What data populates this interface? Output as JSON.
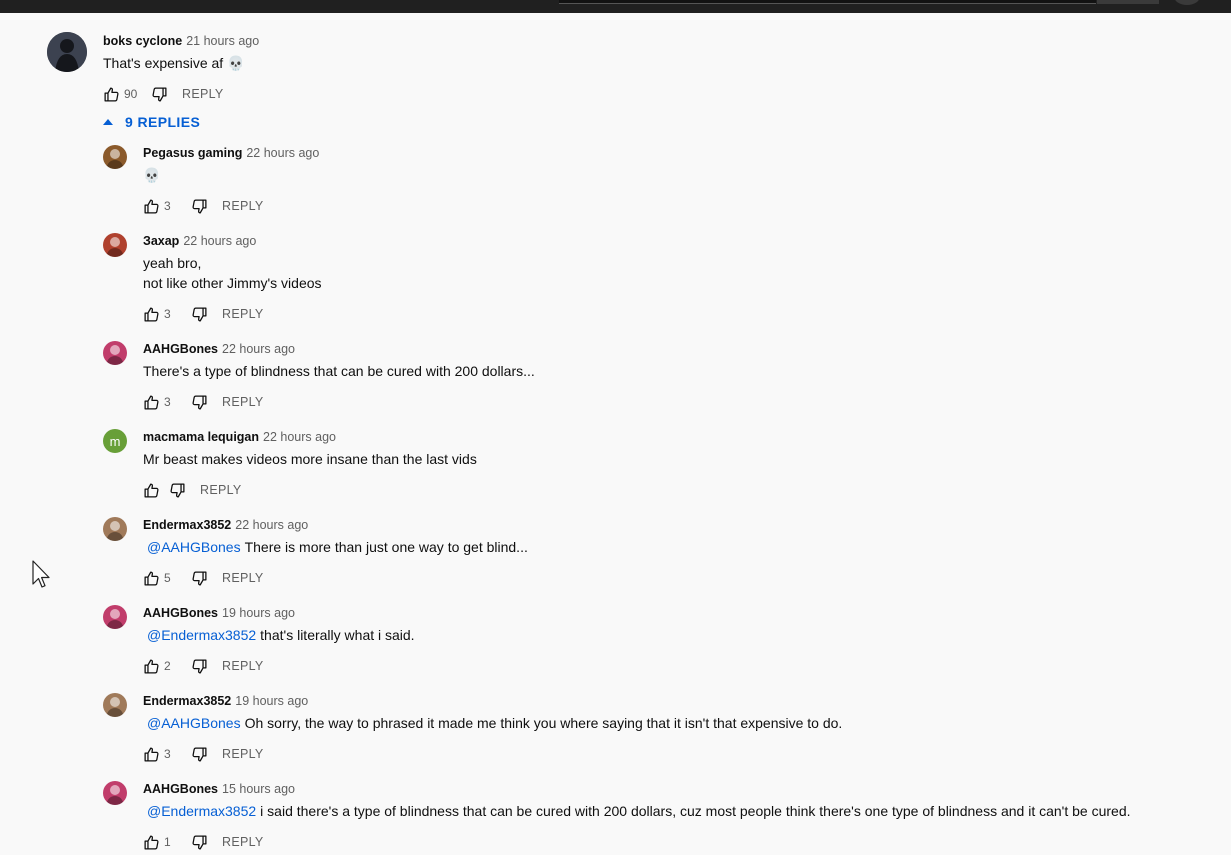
{
  "top_comment": {
    "author": "boks cyclone",
    "time": "21 hours ago",
    "text": "That's expensive af 💀",
    "likes": "90",
    "reply_label": "REPLY"
  },
  "replies_toggle": {
    "label": "9 REPLIES"
  },
  "replies": [
    {
      "author": "Pegasus gaming",
      "time": "22 hours ago",
      "mention": "",
      "lines": [
        "💀"
      ],
      "likes": "3",
      "reply_label": "REPLY",
      "avatar_color": "#8b5a2b"
    },
    {
      "author": "Захар",
      "time": "22 hours ago",
      "mention": "",
      "lines": [
        "yeah bro,",
        "not like other Jimmy's videos"
      ],
      "likes": "3",
      "reply_label": "REPLY",
      "avatar_color": "#b0412e"
    },
    {
      "author": "AAHGBones",
      "time": "22 hours ago",
      "mention": "",
      "lines": [
        "There's a type of blindness that can be cured with 200 dollars..."
      ],
      "likes": "3",
      "reply_label": "REPLY",
      "avatar_color": "#c13d6b"
    },
    {
      "author": "macmama lequigan",
      "time": "22 hours ago",
      "mention": "",
      "lines": [
        "Mr beast makes videos more insane than the last vids"
      ],
      "likes": "",
      "reply_label": "REPLY",
      "avatar_color": "#689f38",
      "avatar_letter": "m"
    },
    {
      "author": "Endermax3852",
      "time": "22 hours ago",
      "mention": "@AAHGBones",
      "lines": [
        "There is more than just one way to get blind..."
      ],
      "likes": "5",
      "reply_label": "REPLY",
      "avatar_color": "#a07a5a"
    },
    {
      "author": "AAHGBones",
      "time": "19 hours ago",
      "mention": "@Endermax3852",
      "lines": [
        "that's literally what i said."
      ],
      "likes": "2",
      "reply_label": "REPLY",
      "avatar_color": "#c13d6b"
    },
    {
      "author": "Endermax3852",
      "time": "19 hours ago",
      "mention": "@AAHGBones",
      "lines": [
        "Oh sorry, the way to phrased it made me think you where saying that it isn't that expensive to do."
      ],
      "likes": "3",
      "reply_label": "REPLY",
      "avatar_color": "#a07a5a"
    },
    {
      "author": "AAHGBones",
      "time": "15 hours ago",
      "mention": "@Endermax3852",
      "lines": [
        "i said there's a type of blindness that can be cured with 200 dollars, cuz most people think there's one type of blindness and it can't be cured."
      ],
      "likes": "1",
      "reply_label": "REPLY",
      "avatar_color": "#c13d6b"
    }
  ],
  "colors": {
    "accent": "#065fd4",
    "background": "#f9f9f9",
    "meta": "#606060"
  }
}
